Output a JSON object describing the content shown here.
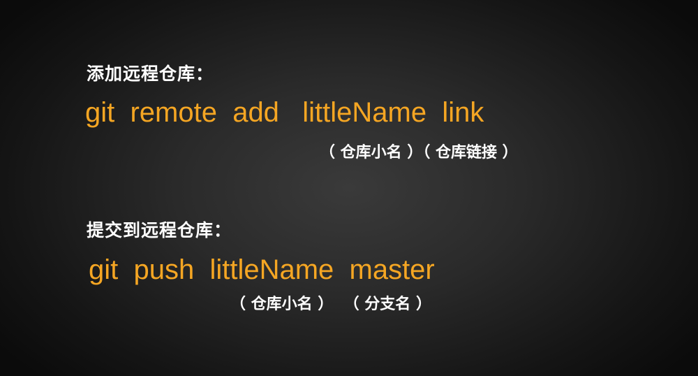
{
  "section_add": {
    "heading": "添加远程仓库：",
    "command": "git  remote  add   littleName  link",
    "annotation": "（ 仓库小名 ）（ 仓库链接 ）"
  },
  "section_push": {
    "heading": "提交到远程仓库：",
    "command": "git  push  littleName  master",
    "annotation": "（ 仓库小名 ）  （ 分支名 ）"
  },
  "colors": {
    "command_text": "#f5a623",
    "heading_text": "#ffffff"
  }
}
